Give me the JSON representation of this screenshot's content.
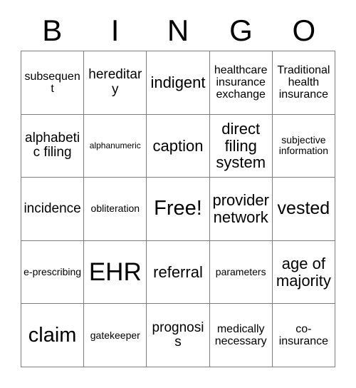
{
  "card": {
    "title_letters": [
      "B",
      "I",
      "N",
      "G",
      "O"
    ],
    "free_space_label": "Free!",
    "rows": [
      [
        {
          "text": "subsequent",
          "size": "fs-md"
        },
        {
          "text": "hereditary",
          "size": "fs-lg"
        },
        {
          "text": "indigent",
          "size": "fs-xl"
        },
        {
          "text": "healthcare insurance exchange",
          "size": "fs-md"
        },
        {
          "text": "Traditional health insurance",
          "size": "fs-md"
        }
      ],
      [
        {
          "text": "alphabetic filing",
          "size": "fs-lg"
        },
        {
          "text": "alphanumeric",
          "size": "fs-xs"
        },
        {
          "text": "caption",
          "size": "fs-xl"
        },
        {
          "text": "direct filing system",
          "size": "fs-xl"
        },
        {
          "text": "subjective information",
          "size": "fs-sm"
        }
      ],
      [
        {
          "text": "incidence",
          "size": "fs-lg"
        },
        {
          "text": "obliteration",
          "size": "fs-sm"
        },
        {
          "text": "Free!",
          "size": "fs-3xl"
        },
        {
          "text": "provider network",
          "size": "fs-xl"
        },
        {
          "text": "vested",
          "size": "fs-2xl"
        }
      ],
      [
        {
          "text": "e-prescribing",
          "size": "fs-sm"
        },
        {
          "text": "EHR",
          "size": "fs-4xl"
        },
        {
          "text": "referral",
          "size": "fs-xl"
        },
        {
          "text": "parameters",
          "size": "fs-sm"
        },
        {
          "text": "age of majority",
          "size": "fs-xl"
        }
      ],
      [
        {
          "text": "claim",
          "size": "fs-3xl"
        },
        {
          "text": "gatekeeper",
          "size": "fs-sm"
        },
        {
          "text": "prognosis",
          "size": "fs-lg"
        },
        {
          "text": "medically necessary",
          "size": "fs-md"
        },
        {
          "text": "co-insurance",
          "size": "fs-md"
        }
      ]
    ]
  },
  "colors": {
    "border": "#7d7d7d",
    "text": "#000000",
    "background": "#ffffff"
  }
}
